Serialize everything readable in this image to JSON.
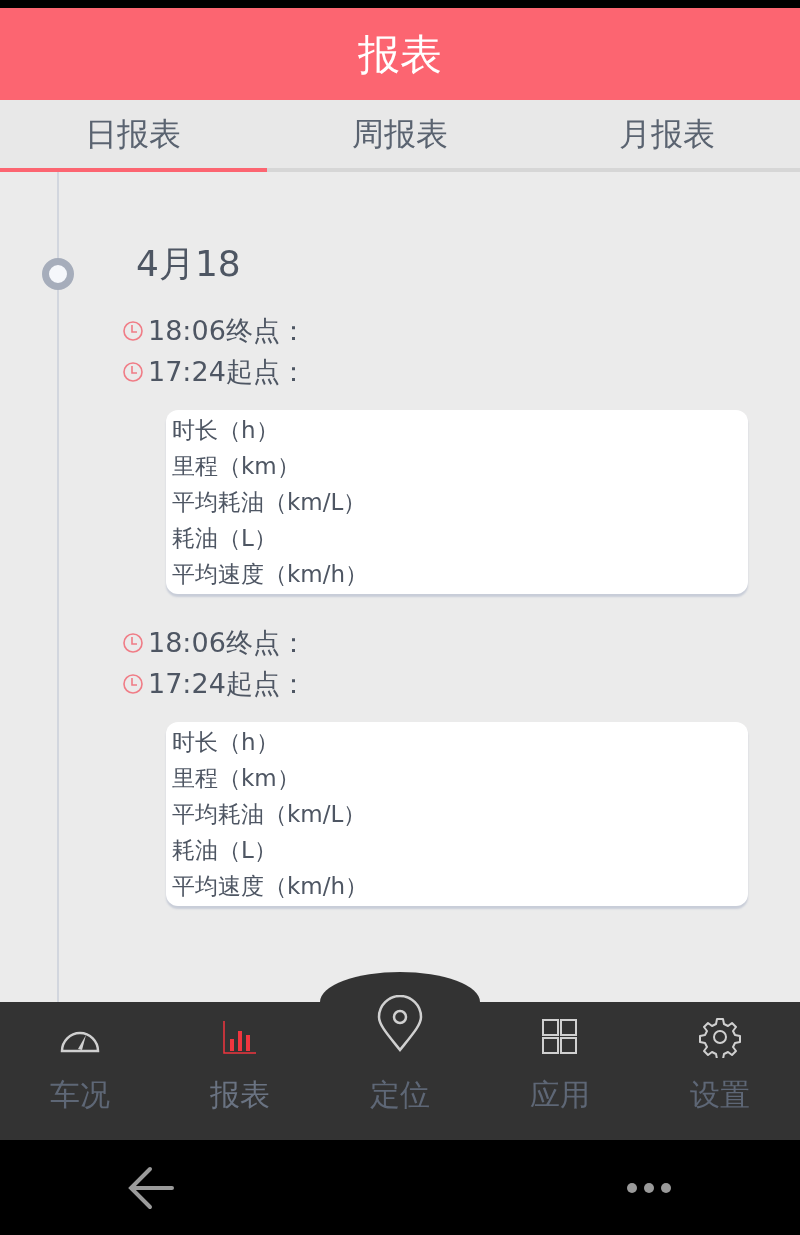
{
  "header": {
    "title": "报表"
  },
  "tabs": [
    {
      "label": "日报表",
      "selected": true
    },
    {
      "label": "周报表",
      "selected": false
    },
    {
      "label": "月报表",
      "selected": false
    }
  ],
  "timeline": {
    "date": "4月18",
    "trips": [
      {
        "end": "18:06终点：",
        "start": "17:24起点：",
        "stats": [
          "时长（h）",
          "里程（km）",
          "平均耗油（km/L）",
          "耗油（L）",
          "平均速度（km/h）"
        ]
      },
      {
        "end": "18:06终点：",
        "start": "17:24起点：",
        "stats": [
          "时长（h）",
          "里程（km）",
          "平均耗油（km/L）",
          "耗油（L）",
          "平均速度（km/h）"
        ]
      }
    ]
  },
  "bottom_nav": [
    {
      "label": "车况",
      "selected": false,
      "kind": "flat"
    },
    {
      "label": "报表",
      "selected": true,
      "kind": "flat"
    },
    {
      "label": "定位",
      "selected": false,
      "kind": "raised"
    },
    {
      "label": "应用",
      "selected": false,
      "kind": "flat"
    },
    {
      "label": "设置",
      "selected": false,
      "kind": "flat"
    }
  ]
}
